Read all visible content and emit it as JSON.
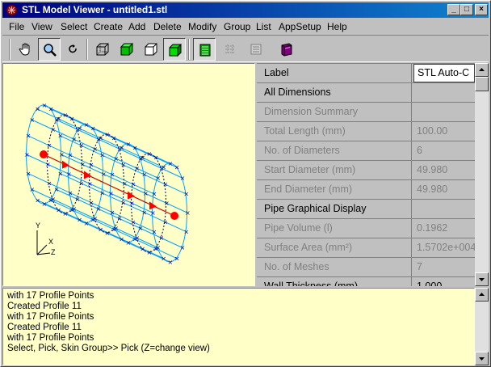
{
  "window": {
    "title": "STL Model Viewer - untitled1.stl",
    "controls": [
      "_",
      "□",
      "×"
    ]
  },
  "menu": [
    "File",
    "View",
    "Select",
    "Create",
    "Add",
    "Delete",
    "Modify",
    "Group",
    "List",
    "AppSetup",
    "Help"
  ],
  "toolbar": {
    "tools": [
      {
        "icon": "hand-pan-icon",
        "pressed": false
      },
      {
        "icon": "magnifier-zoom-icon",
        "pressed": true
      },
      {
        "icon": "rotate-icon",
        "pressed": false
      },
      {
        "icon": "wireframe-cube-icon",
        "pressed": false
      },
      {
        "icon": "green-cube-icon",
        "pressed": false
      },
      {
        "icon": "outline-cube-icon",
        "pressed": false
      },
      {
        "icon": "shaded-cube-icon",
        "pressed": true
      },
      {
        "icon": "table-icon",
        "pressed": true
      },
      {
        "icon": "mesh-disabled-icon",
        "pressed": false
      },
      {
        "icon": "list-icon",
        "pressed": false
      },
      {
        "icon": "book-icon",
        "pressed": false
      }
    ]
  },
  "viewport": {
    "background": "#ffffc8",
    "mesh_color": "#00a0ff",
    "axis_color": "#cc0000",
    "node_color": "#ff0000",
    "axes": {
      "x": "X",
      "y": "Y",
      "z": "Z"
    }
  },
  "properties": {
    "header_label": "Label",
    "header_value": "STL Auto-C",
    "rows": [
      {
        "label": "All Dimensions",
        "value": "",
        "dim": false
      },
      {
        "label": "Dimension Summary",
        "value": "",
        "dim": true
      },
      {
        "label": "Total Length (mm)",
        "value": "100.00",
        "dim": true
      },
      {
        "label": "No. of Diameters",
        "value": "6",
        "dim": true
      },
      {
        "label": "Start Diameter (mm)",
        "value": "49.980",
        "dim": true
      },
      {
        "label": "End Diameter (mm)",
        "value": "49.980",
        "dim": true
      },
      {
        "label": "Pipe Graphical Display",
        "value": "",
        "dim": false
      },
      {
        "label": "Pipe Volume (l)",
        "value": "0.1962",
        "dim": true
      },
      {
        "label": "Surface Area (mm²)",
        "value": "1.5702e+004",
        "dim": true
      },
      {
        "label": "No. of Meshes",
        "value": "7",
        "dim": true
      },
      {
        "label": "Wall Thickness (mm)",
        "value": "1.000",
        "dim": false
      }
    ]
  },
  "console": {
    "lines": [
      "with 17 Profile Points",
      "Created Profile 11",
      "with 17 Profile Points",
      "Created Profile 11",
      "with 17 Profile Points",
      "Select, Pick, Skin Group>> Pick (Z=change view)"
    ]
  }
}
